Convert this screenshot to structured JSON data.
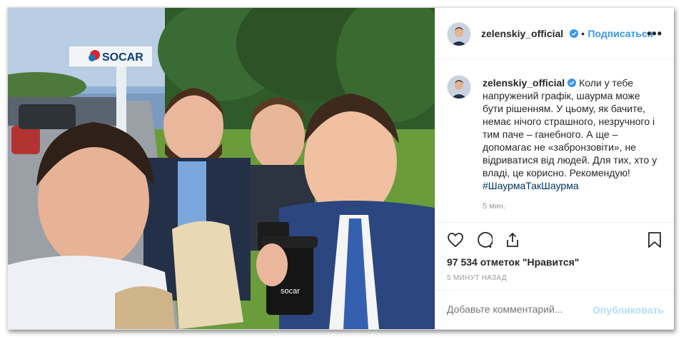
{
  "header": {
    "username": "zelenskiy_official",
    "follow_label": "Подписаться",
    "more_label": "•••"
  },
  "photo": {
    "sign_text": "SOCAR",
    "cup_logo": "socar"
  },
  "caption": {
    "username": "zelenskiy_official",
    "text": "Коли у тебе напружений графік, шаурма може бути рішенням. У цьому, як бачите, немає нічого страшного, незручного і тим паче – ганебного. А ще – допомагає не «забронзовіти», не відриватися від людей. Для тих, хто у владі, це корисно. Рекомендую!",
    "hashtag": "#ШаурмаТакШаурма",
    "time": "5 мин."
  },
  "actions": {
    "icons": [
      "heart-icon",
      "comment-icon",
      "share-icon",
      "bookmark-icon"
    ],
    "likes": "97 534 отметок \"Нравится\"",
    "time_ago": "5 МИНУТ НАЗАД"
  },
  "comment": {
    "placeholder": "Добавьте комментарий...",
    "post_label": "Опубликовать"
  },
  "colors": {
    "link_blue": "#3897f0",
    "hashtag_blue": "#003569",
    "border": "#dbdbdb",
    "verified": "#3897f0"
  }
}
